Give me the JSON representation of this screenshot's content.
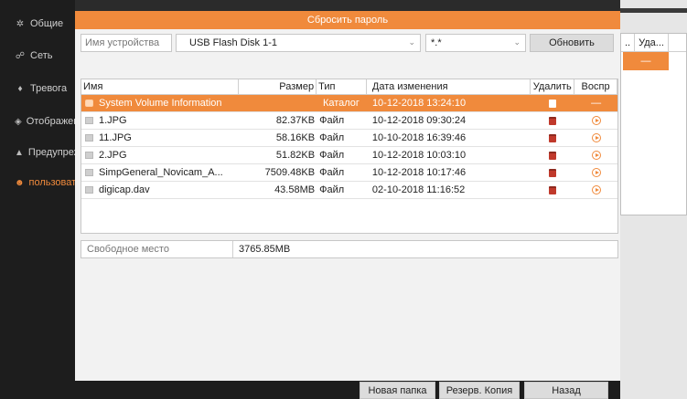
{
  "sidebar": {
    "items": [
      {
        "label": "Общие",
        "icon": "gear-icon",
        "glyph": "✲"
      },
      {
        "label": "Сеть",
        "icon": "network-icon",
        "glyph": "☍"
      },
      {
        "label": "Тревога",
        "icon": "alarm-icon",
        "glyph": "♦"
      },
      {
        "label": "Отображение",
        "icon": "display-icon",
        "glyph": "◈"
      },
      {
        "label": "Предупреждение",
        "icon": "warning-icon",
        "glyph": "▲"
      },
      {
        "label": "пользователь",
        "icon": "user-icon",
        "glyph": "☻"
      }
    ]
  },
  "background_table": {
    "headers": [
      "..",
      "Уда..."
    ],
    "selected_marker": "—"
  },
  "dialog": {
    "title": "Сбросить пароль",
    "device_label": "Имя устройства",
    "device_value": "USB Flash Disk 1-1",
    "filter_value": "*.*",
    "refresh_label": "Обновить",
    "columns": {
      "name": "Имя",
      "size": "Размер",
      "type": "Тип",
      "date": "Дата изменения",
      "delete": "Удалить",
      "play": "Воспр"
    },
    "files": [
      {
        "name": "System Volume Information",
        "size": "",
        "type": "Каталог",
        "date": "10-12-2018 13:24:10",
        "selected": true
      },
      {
        "name": "1.JPG",
        "size": "82.37KB",
        "type": "Файл",
        "date": "10-12-2018 09:30:24",
        "selected": false
      },
      {
        "name": "11.JPG",
        "size": "58.16KB",
        "type": "Файл",
        "date": "10-10-2018 16:39:46",
        "selected": false
      },
      {
        "name": "2.JPG",
        "size": "51.82KB",
        "type": "Файл",
        "date": "10-12-2018 10:03:10",
        "selected": false
      },
      {
        "name": "SimpGeneral_Novicam_A...",
        "size": "7509.48KB",
        "type": "Файл",
        "date": "10-12-2018 10:17:46",
        "selected": false
      },
      {
        "name": "digicap.dav",
        "size": "43.58MB",
        "type": "Файл",
        "date": "02-10-2018 11:16:52",
        "selected": false
      }
    ],
    "free_space_label": "Свободное место",
    "free_space_value": "3765.85MB",
    "buttons": {
      "new_folder": "Новая папка",
      "backup": "Резерв. Копия",
      "back": "Назад"
    }
  },
  "colors": {
    "accent": "#f08a3c",
    "sidebar_bg": "#1d1d1d",
    "trash": "#c0392b"
  }
}
